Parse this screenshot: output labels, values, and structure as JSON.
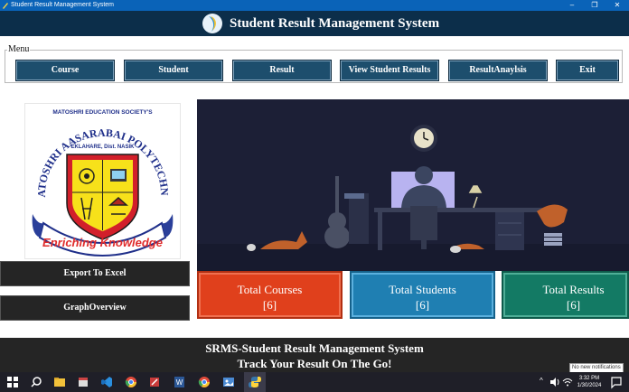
{
  "window": {
    "title": "Student Result Management System",
    "controls": [
      "–",
      "❐",
      "✕"
    ]
  },
  "header": {
    "title": "Student Result Management System"
  },
  "menu": {
    "legend": "Menu",
    "buttons": [
      "Course",
      "Student",
      "Result",
      "View Student Results",
      "ResultAnaylsis",
      "Exit"
    ]
  },
  "logo": {
    "society": "MATOSHRI EDUCATION SOCIETY'S",
    "name": "MATOSHRI AASARABAI POLYTECHNIC",
    "place": "EKLAHARE, Dist. NASIK",
    "motto": "Enriching Knowledge"
  },
  "left_buttons": {
    "export": "Export To Excel",
    "graph": "GraphOverview"
  },
  "stats": [
    {
      "label": "Total Courses",
      "value": "[6]",
      "color": "#e0401c"
    },
    {
      "label": "Total Students",
      "value": "[6]",
      "color": "#1f7fb2"
    },
    {
      "label": "Total Results",
      "value": "[6]",
      "color": "#137a64"
    }
  ],
  "footer": {
    "line1": "SRMS-Student Result Management System",
    "line2": "Track Your Result On The Go!"
  },
  "taskbar": {
    "time": "3:32 PM",
    "date": "1/30/2024",
    "notification": "No new notifications"
  }
}
